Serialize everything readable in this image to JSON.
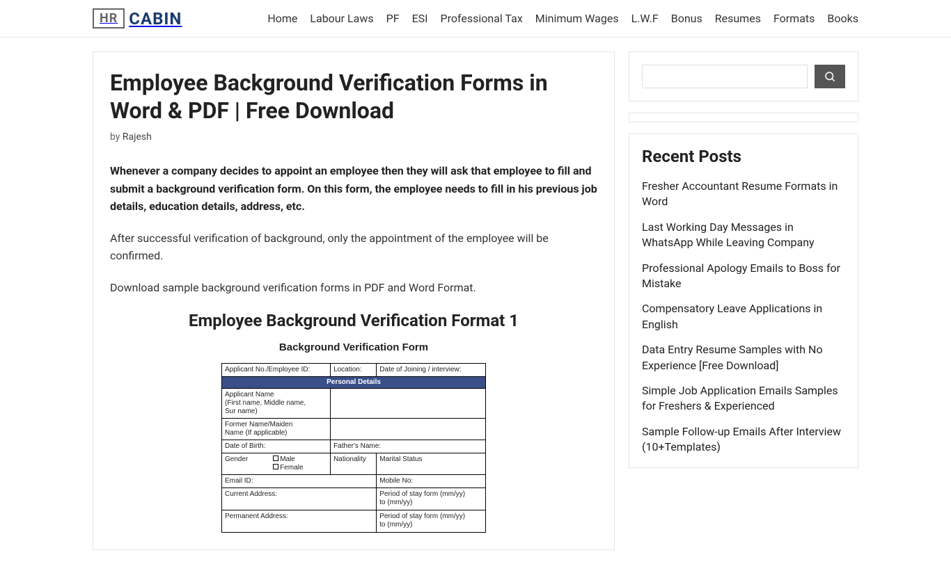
{
  "site": {
    "logo1": "HR",
    "logo2": "CABIN"
  },
  "nav": [
    "Home",
    "Labour Laws",
    "PF",
    "ESI",
    "Professional Tax",
    "Minimum Wages",
    "L.W.F",
    "Bonus",
    "Resumes",
    "Formats",
    "Books"
  ],
  "article": {
    "title": "Employee Background Verification Forms in Word & PDF | Free Download",
    "by": "by ",
    "author": "Rajesh",
    "p1": "Whenever a company decides to appoint an employee then they will ask that employee to fill and submit a background verification form. On this form, the employee needs to fill in his previous job details, education details, address, etc.",
    "p2": "After successful verification of background, only the appointment of the employee will be confirmed.",
    "p3": "Download sample background verification forms in PDF and Word Format.",
    "format_title": "Employee Background Verification Format 1",
    "form": {
      "title": "Background Verification Form",
      "r1c1": "Applicant No./Employee ID:",
      "r1c2": "Location:",
      "r1c3": "Date of Joining / interview:",
      "sec1": "Personal Details",
      "name_lbl": "Applicant Name\n(First name, Middle name,\nSur name)",
      "former": "Former Name/Maiden\nName (If applicable)",
      "dob": "Date of Birth:",
      "father": "Father's Name:",
      "gender": "Gender",
      "male": "Male",
      "female": "Female",
      "nationality": "Nationality",
      "marital": "Marital Status",
      "email": "Email ID:",
      "mobile": "Mobile No:",
      "curaddr": "Current Address:",
      "period1": "Period of stay form (mm/yy)\nto (mm/yy)",
      "permaddr": "Permanent Address:",
      "period2": "Period of stay form (mm/yy)\nto (mm/yy)"
    }
  },
  "sidebar": {
    "recent_title": "Recent Posts",
    "posts": [
      "Fresher Accountant Resume Formats in Word",
      "Last Working Day Messages in WhatsApp While Leaving Company",
      "Professional Apology Emails to Boss for Mistake",
      "Compensatory Leave Applications in English",
      "Data Entry Resume Samples with No Experience [Free Download]",
      "Simple Job Application Emails Samples for Freshers & Experienced",
      "Sample Follow-up Emails After Interview (10+Templates)"
    ]
  }
}
